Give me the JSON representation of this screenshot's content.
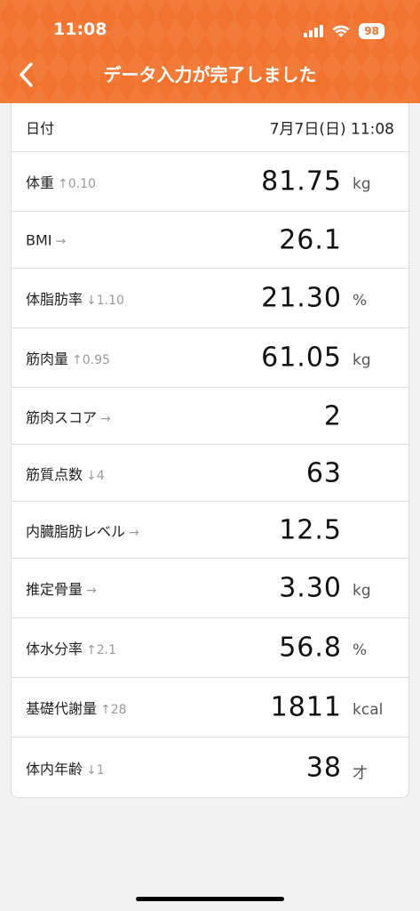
{
  "status_bar": {
    "time": "11:08",
    "battery": "98"
  },
  "header": {
    "title": "データ入力が完了しました"
  },
  "date_row": {
    "label": "日付",
    "value": "7月7日(日) 11:08"
  },
  "rows": [
    {
      "label": "体重",
      "delta": "↑0.10",
      "value": "81.75",
      "unit": "kg"
    },
    {
      "label": "BMI",
      "delta": "→",
      "value": "26.1",
      "unit": ""
    },
    {
      "label": "体脂肪率",
      "delta": "↓1.10",
      "value": "21.30",
      "unit": "%"
    },
    {
      "label": "筋肉量",
      "delta": "↑0.95",
      "value": "61.05",
      "unit": "kg"
    },
    {
      "label": "筋肉スコア",
      "delta": "→",
      "value": "2",
      "unit": ""
    },
    {
      "label": "筋質点数",
      "delta": "↓4",
      "value": "63",
      "unit": ""
    },
    {
      "label": "内臓脂肪レベル",
      "delta": "→",
      "value": "12.5",
      "unit": ""
    },
    {
      "label": "推定骨量",
      "delta": "→",
      "value": "3.30",
      "unit": "kg"
    },
    {
      "label": "体水分率",
      "delta": "↑2.1",
      "value": "56.8",
      "unit": "%"
    },
    {
      "label": "基礎代謝量",
      "delta": "↑28",
      "value": "1811",
      "unit": "kcal"
    },
    {
      "label": "体内年齢",
      "delta": "↓1",
      "value": "38",
      "unit": "才"
    }
  ],
  "colors": {
    "header": "#f2732e",
    "background": "#f2f2f2"
  },
  "icons": {
    "back": "chevron-left-icon",
    "wifi": "wifi-icon",
    "signal": "signal-icon"
  }
}
